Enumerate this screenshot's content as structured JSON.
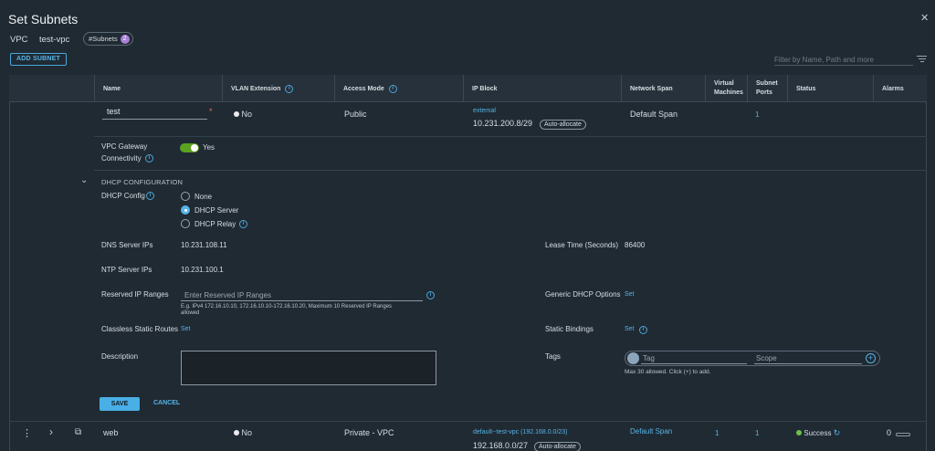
{
  "dialog": {
    "title": "Set Subnets",
    "close_icon": "✕"
  },
  "context": {
    "vpc_label": "VPC",
    "vpc_name": "test-vpc",
    "subnets_pill_label": "#Subnets",
    "subnets_count": "2"
  },
  "toolbar": {
    "add_subnet_label": "ADD SUBNET",
    "filter_placeholder": "Filter by Name, Path and more"
  },
  "table": {
    "columns": {
      "name": "Name",
      "vlan": "VLAN Extension",
      "access": "Access Mode",
      "ipblock": "IP Block",
      "span": "Network Span",
      "vm_line1": "Virtual",
      "vm_line2": "Machines",
      "ports_line1": "Subnet",
      "ports_line2": "Ports",
      "status": "Status",
      "alarms": "Alarms"
    }
  },
  "edit_row": {
    "name_value": "test",
    "vlan": "No",
    "access_mode": "Public",
    "ip_block_name": "external",
    "ip_block_cidr": "10.231.200.8/29",
    "ip_block_badge": "Auto-allocate",
    "network_span": "Default Span",
    "subnet_ports": "1",
    "gateway_label_1": "VPC Gateway",
    "gateway_label_2": "Connectivity",
    "gateway_value": "Yes",
    "dhcp_section": "DHCP CONFIGURATION",
    "dhcp_config_label": "DHCP Config",
    "dhcp_options": [
      "None",
      "DHCP Server",
      "DHCP Relay"
    ],
    "dhcp_selected": "DHCP Server",
    "dns_label": "DNS Server IPs",
    "dns_value": "10.231.108.11",
    "lease_label": "Lease Time (Seconds)",
    "lease_value": "86400",
    "ntp_label": "NTP Server IPs",
    "ntp_value": "10.231.100.1",
    "reserved_label": "Reserved IP Ranges",
    "reserved_placeholder": "Enter Reserved IP Ranges",
    "reserved_hint_1": "E.g. IPv4 172.16.10.10, 172.16.10.10-172.16.10.20, Maximum 10 Reserved IP Ranges",
    "reserved_hint_2": "allowed",
    "generic_dhcp_label": "Generic DHCP Options",
    "generic_dhcp_link": "Set",
    "classless_label": "Classless Static Routes",
    "classless_link": "Set",
    "static_bindings_label": "Static Bindings",
    "static_bindings_link": "Set",
    "description_label": "Description",
    "tags_label": "Tags",
    "tag_placeholder": "Tag",
    "scope_placeholder": "Scope",
    "tags_hint": "Max 30 allowed. Click (+) to add.",
    "save_label": "SAVE",
    "cancel_label": "CANCEL"
  },
  "web_row": {
    "name": "web",
    "vlan": "No",
    "access_mode": "Private - VPC",
    "ip_block_name": "default--test-vpc (192.168.0.0/23)",
    "ip_block_cidr": "192.168.0.0/27",
    "ip_block_badge": "Auto-allocate",
    "network_span": "Default Span",
    "vms": "1",
    "subnet_ports": "1",
    "status": "Success",
    "alarms": "0"
  },
  "icons": {
    "info": "i",
    "chevron_down": "⌄",
    "chevron_right": "›",
    "kebab": "⋮",
    "refresh": "↻",
    "plus": "+",
    "linked": "⧉"
  },
  "colors": {
    "accent": "#55b4e6",
    "toggle_on": "#5aa220",
    "success": "#6cc04a",
    "badge_purple": "#a57fd7",
    "required": "#e26d6d"
  }
}
